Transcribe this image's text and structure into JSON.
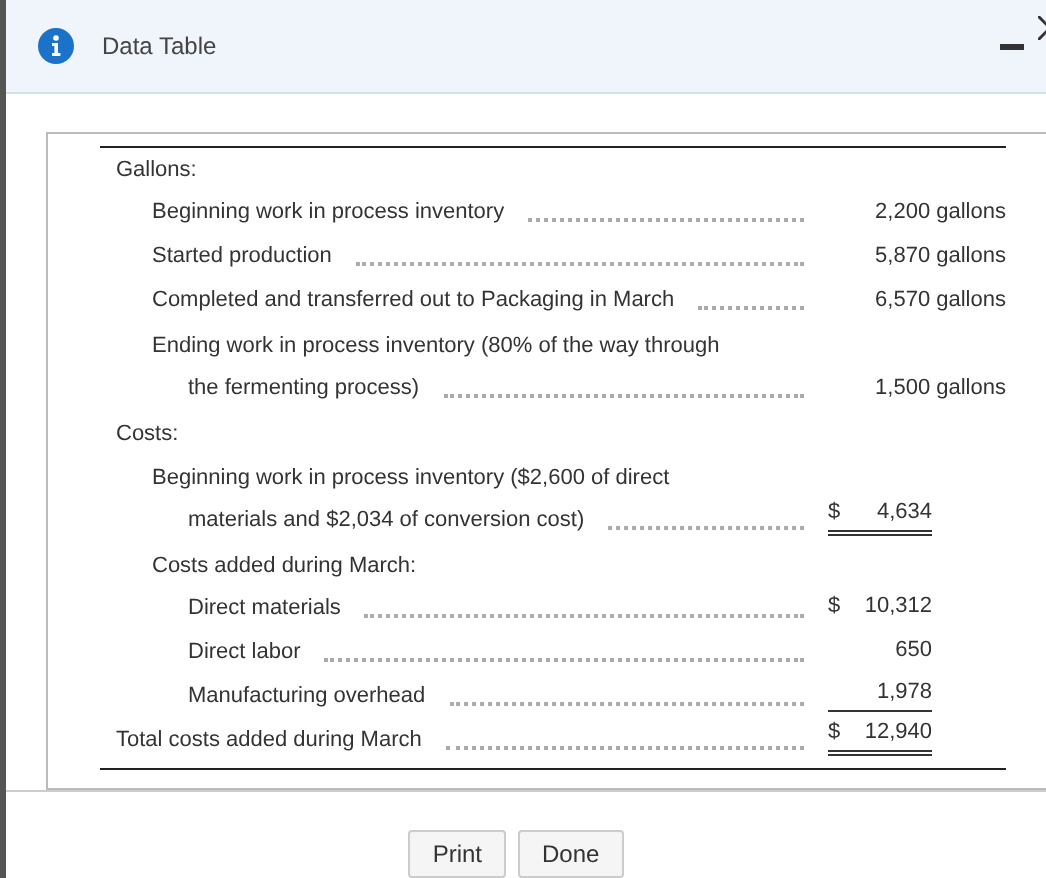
{
  "window": {
    "title": "Data Table"
  },
  "items": [
    {
      "kind": "group",
      "title": "Gallons:",
      "children": [
        {
          "kind": "quantity",
          "lines": [
            "Beginning work in process inventory"
          ],
          "value": "2,200 gallons"
        },
        {
          "kind": "quantity",
          "lines": [
            "Started production"
          ],
          "value": "5,870 gallons"
        },
        {
          "kind": "quantity",
          "lines": [
            "Completed and transferred out to Packaging in March"
          ],
          "value": "6,570 gallons"
        },
        {
          "kind": "quantity",
          "lines": [
            "Ending work in process inventory (80% of the way through",
            "the fermenting process)"
          ],
          "value": "1,500 gallons"
        }
      ]
    },
    {
      "kind": "group",
      "title": "Costs:",
      "children": [
        {
          "kind": "money",
          "lines": [
            "Beginning work in process inventory ($2,600 of direct",
            "materials and $2,034 of conversion cost)"
          ],
          "currency": "$",
          "value": "4,634",
          "double_underlined": true
        },
        {
          "kind": "group",
          "title": "Costs added during March:",
          "children": [
            {
              "kind": "money",
              "lines": [
                "Direct materials"
              ],
              "currency": "$",
              "value": "10,312"
            },
            {
              "kind": "money",
              "lines": [
                "Direct labor"
              ],
              "value": "650"
            },
            {
              "kind": "money",
              "lines": [
                "Manufacturing overhead"
              ],
              "value": "1,978",
              "underlined": true
            }
          ]
        }
      ]
    },
    {
      "kind": "money",
      "lines": [
        "Total costs added during March"
      ],
      "currency": "$",
      "value": "12,940",
      "double_underlined": true
    }
  ],
  "buttons": [
    "Print",
    "Done"
  ]
}
